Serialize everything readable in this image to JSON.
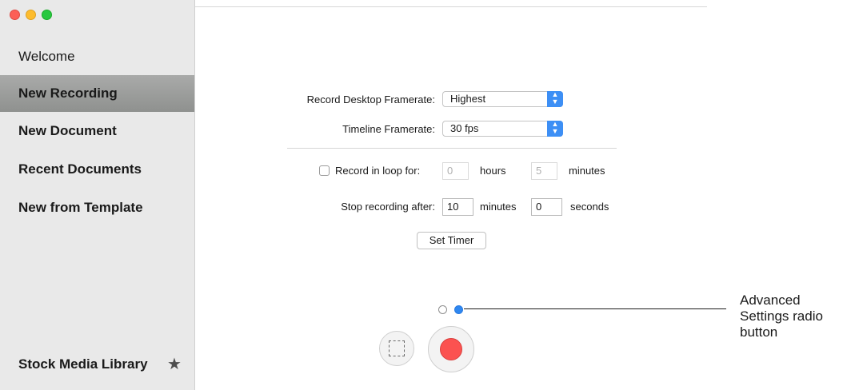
{
  "sidebar": {
    "items": [
      {
        "label": "Welcome"
      },
      {
        "label": "New Recording"
      },
      {
        "label": "New Document"
      },
      {
        "label": "Recent Documents"
      },
      {
        "label": "New from Template"
      }
    ],
    "selected": "New Recording",
    "footer_label": "Stock Media Library",
    "footer_icon": "star-icon"
  },
  "settings": {
    "desktop_framerate_label": "Record Desktop Framerate:",
    "desktop_framerate_value": "Highest",
    "timeline_framerate_label": "Timeline Framerate:",
    "timeline_framerate_value": "30 fps",
    "loop_label": "Record in loop for:",
    "loop_checked": false,
    "loop_hours_value": "0",
    "loop_hours_unit": "hours",
    "loop_minutes_value": "5",
    "loop_minutes_unit": "minutes",
    "stop_label": "Stop recording after:",
    "stop_minutes_value": "10",
    "stop_minutes_unit": "minutes",
    "stop_seconds_value": "0",
    "stop_seconds_unit": "seconds",
    "set_timer_label": "Set Timer"
  },
  "pager": {
    "pages": 2,
    "selected_page": 2
  },
  "callout": {
    "line1": "Advanced",
    "line2": "Settings radio",
    "line3": "button"
  },
  "colors": {
    "accent": "#2f87f0",
    "record": "#fb5250",
    "sidebar_bg": "#e9e9e9"
  }
}
